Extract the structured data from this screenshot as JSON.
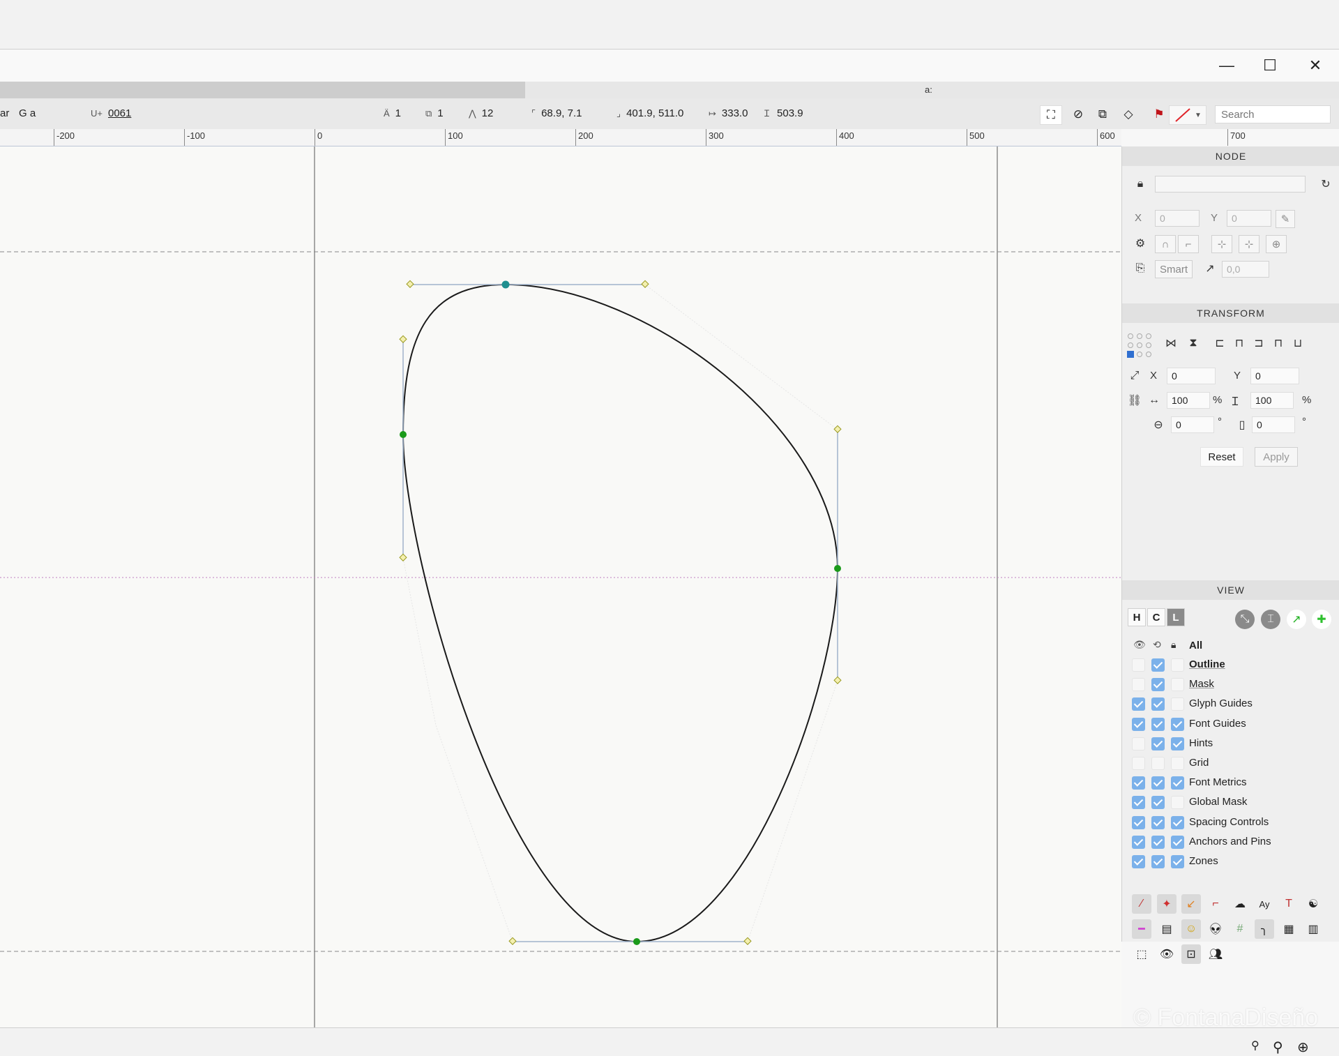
{
  "window": {
    "controls": [
      "—",
      "☐",
      "✕"
    ],
    "glyph_label": "a:"
  },
  "toolbar": {
    "glyph_name_partial": "ar",
    "glyph_preview": "G a",
    "unicode_label": "U+",
    "unicode_value": "0061",
    "contours": "1",
    "components": "1",
    "nodes": "12",
    "selection_origin": "68.9, 7.1",
    "selection_end": "401.9, 511.0",
    "width": "333.0",
    "height": "503.9",
    "search_placeholder": "Search"
  },
  "ruler": {
    "ticks": [
      "-200",
      "-100",
      "0",
      "100",
      "200",
      "300",
      "400",
      "500",
      "600",
      "700"
    ]
  },
  "canvas": {
    "advance_width": "525",
    "glyph_small_label": "a"
  },
  "node_panel": {
    "title": "NODE",
    "x_label": "X",
    "y_label": "Y",
    "x_value": "0",
    "y_value": "0",
    "smart_label": "Smart",
    "angle_value": "0,0"
  },
  "transform_panel": {
    "title": "TRANSFORM",
    "x_label": "X",
    "y_label": "Y",
    "x_value": "0",
    "y_value": "0",
    "scale_w": "100",
    "scale_h": "100",
    "percent": "%",
    "rotate": "0",
    "slant": "0",
    "degree": "°",
    "reset_label": "Reset",
    "apply_label": "Apply"
  },
  "view_panel": {
    "title": "VIEW",
    "mode_buttons": [
      "H",
      "C",
      "L"
    ],
    "all_label": "All",
    "layers": [
      {
        "name": "Outline",
        "c1": false,
        "c2": true,
        "c3": false
      },
      {
        "name": "Mask",
        "c1": false,
        "c2": true,
        "c3": false
      },
      {
        "name": "Glyph Guides",
        "c1": true,
        "c2": true,
        "c3": false
      },
      {
        "name": "Font Guides",
        "c1": true,
        "c2": true,
        "c3": true
      },
      {
        "name": "Hints",
        "c1": false,
        "c2": true,
        "c3": true
      },
      {
        "name": "Grid",
        "c1": false,
        "c2": false,
        "c3": false
      },
      {
        "name": "Font Metrics",
        "c1": true,
        "c2": true,
        "c3": true
      },
      {
        "name": "Global Mask",
        "c1": true,
        "c2": true,
        "c3": false
      },
      {
        "name": "Spacing Controls",
        "c1": true,
        "c2": true,
        "c3": true
      },
      {
        "name": "Anchors and Pins",
        "c1": true,
        "c2": true,
        "c3": true
      },
      {
        "name": "Zones",
        "c1": true,
        "c2": true,
        "c3": true
      }
    ]
  },
  "watermark": "© FontanaDiseño",
  "colors": {
    "node_green": "#1a9a1a",
    "node_teal": "#1f8f8f",
    "handle_yellow": "#d8d878",
    "check_blue": "#7bb1ea",
    "baseline_magenta": "#c080c0"
  }
}
